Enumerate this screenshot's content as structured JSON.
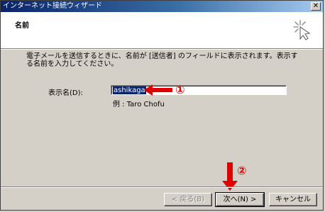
{
  "window": {
    "title": "インターネット接続ウィザード",
    "close_symbol": "✕"
  },
  "header": {
    "title": "名前",
    "icon": "wizard-sparkle-icon"
  },
  "body": {
    "instruction": "電子メールを送信するときに、名前が [送信者] のフィールドに表示されます。表示する名前を入力してください。",
    "display_name_label": "表示名(D):",
    "display_name_value": "ashikaga",
    "example": "例 : Taro Chofu"
  },
  "annotations": {
    "marker_1": "①",
    "marker_2": "②",
    "color": "#e00000"
  },
  "buttons": {
    "back": "< 戻る(B)",
    "next": "次へ(N) >",
    "cancel": "キャンセル"
  }
}
